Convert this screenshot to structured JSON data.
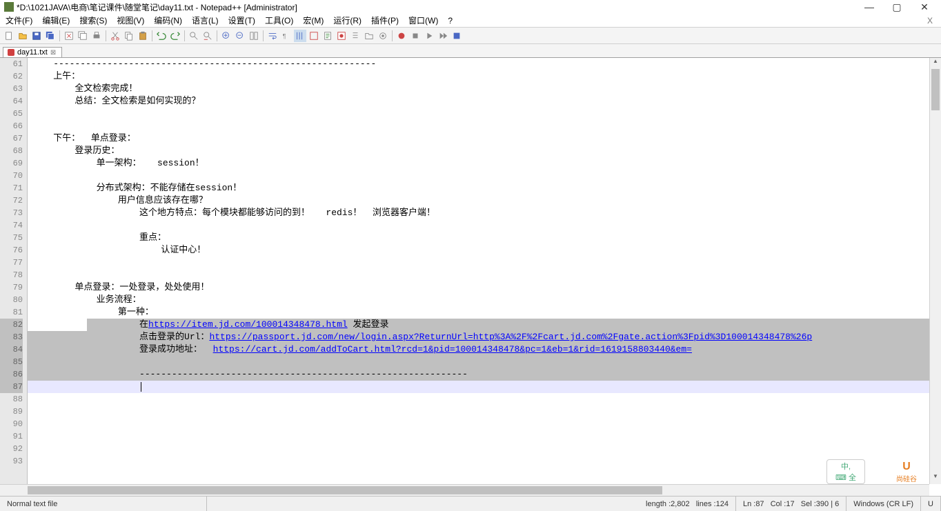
{
  "window": {
    "title": "*D:\\1021JAVA\\电商\\笔记课件\\随堂笔记\\day11.txt - Notepad++ [Administrator]"
  },
  "menu": {
    "file": "文件(F)",
    "edit": "编辑(E)",
    "search": "搜索(S)",
    "view": "视图(V)",
    "encoding": "编码(N)",
    "language": "语言(L)",
    "settings": "设置(T)",
    "tools": "工具(O)",
    "macro": "宏(M)",
    "run": "运行(R)",
    "plugins": "插件(P)",
    "window": "窗口(W)",
    "help": "?",
    "close_x": "X"
  },
  "tab": {
    "name": "day11.txt"
  },
  "lines": {
    "start": 61,
    "content": [
      {
        "n": 61,
        "t": "    ------------------------------------------------------------"
      },
      {
        "n": 62,
        "t": "    上午："
      },
      {
        "n": 63,
        "t": "        全文检索完成！"
      },
      {
        "n": 64,
        "t": "        总结：全文检索是如何实现的？"
      },
      {
        "n": 65,
        "t": ""
      },
      {
        "n": 66,
        "t": ""
      },
      {
        "n": 67,
        "t": "    下午：  单点登录："
      },
      {
        "n": 68,
        "t": "        登录历史："
      },
      {
        "n": 69,
        "t": "            单一架构：   session！"
      },
      {
        "n": 70,
        "t": ""
      },
      {
        "n": 71,
        "t": "            分布式架构：不能存储在session！"
      },
      {
        "n": 72,
        "t": "                用户信息应该存在哪？"
      },
      {
        "n": 73,
        "t": "                    这个地方特点：每个模块都能够访问的到！   redis！  浏览器客户端！"
      },
      {
        "n": 74,
        "t": ""
      },
      {
        "n": 75,
        "t": "                    重点："
      },
      {
        "n": 76,
        "t": "                        认证中心！"
      },
      {
        "n": 77,
        "t": ""
      },
      {
        "n": 78,
        "t": ""
      },
      {
        "n": 79,
        "t": "        单点登录：一处登录，处处使用！"
      },
      {
        "n": 80,
        "t": "            业务流程："
      },
      {
        "n": 81,
        "t": "                第一种："
      },
      {
        "n": 82,
        "t": "                    ",
        "link_pre": "在",
        "link": "https://item.jd.com/100014348478.html",
        "link_post": " 发起登录",
        "sel": true,
        "sel_from": 10
      },
      {
        "n": 83,
        "t": "                    点击登录的Url：",
        "link": "https://passport.jd.com/new/login.aspx?ReturnUrl=http%3A%2F%2Fcart.jd.com%2Fgate.action%3Fpid%3D100014348478%26p",
        "sel": true
      },
      {
        "n": 84,
        "t": "                    登录成功地址：  ",
        "link": "https://cart.jd.com/addToCart.html?rcd=1&pid=100014348478&pc=1&eb=1&rid=1619158803440&em=",
        "sel": true
      },
      {
        "n": 85,
        "t": "                    ",
        "sel": true
      },
      {
        "n": 86,
        "t": "                    -------------------------------------------------------------",
        "sel": true
      },
      {
        "n": 87,
        "t": "                    ",
        "current": true
      },
      {
        "n": 88,
        "t": ""
      },
      {
        "n": 89,
        "t": ""
      },
      {
        "n": 90,
        "t": ""
      },
      {
        "n": 91,
        "t": ""
      },
      {
        "n": 92,
        "t": ""
      },
      {
        "n": 93,
        "t": ""
      }
    ]
  },
  "status": {
    "filetype": "Normal text file",
    "length_label": "length : ",
    "length": "2,802",
    "lines_label": "lines : ",
    "lines": "124",
    "ln_label": "Ln : ",
    "ln": "87",
    "col_label": "Col : ",
    "col": "17",
    "sel_label": "Sel : ",
    "sel": "390 | 6",
    "eol": "Windows (CR LF)",
    "enc": "U"
  },
  "ime": {
    "text": "中,\n⌨ 全"
  },
  "logo": {
    "u": "U",
    "name": "尚硅谷"
  }
}
